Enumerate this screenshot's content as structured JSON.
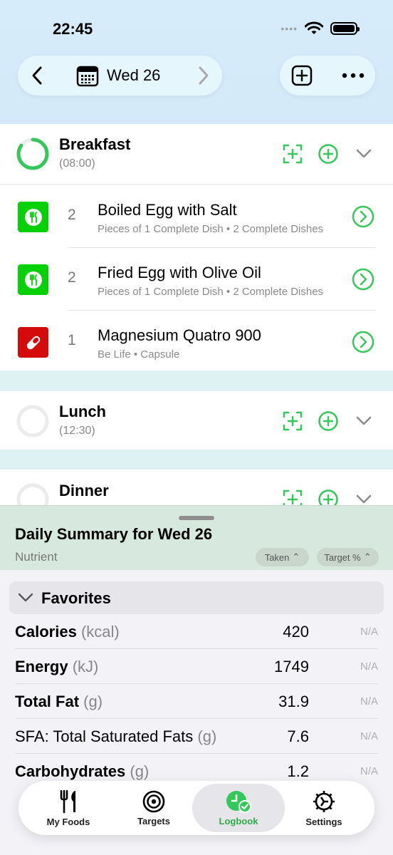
{
  "status_bar": {
    "time": "22:45"
  },
  "nav": {
    "date": "Wed 26",
    "icons": [
      "chevron-left-icon",
      "calendar-icon",
      "chevron-right-icon",
      "plus-square-icon",
      "more-icon"
    ]
  },
  "colors": {
    "accent_green": "#34c759",
    "food_green": "#06d006",
    "supplement_red": "#d50b0b"
  },
  "meals": [
    {
      "title": "Breakfast",
      "time": "(08:00)",
      "progress": 0.85,
      "items": [
        {
          "qty": "2",
          "name": "Boiled Egg with Salt",
          "sub": "Pieces of 1 Complete Dish • 2 Complete Dishes",
          "icon": "fork-knife-icon"
        },
        {
          "qty": "2",
          "name": "Fried Egg with Olive Oil",
          "sub": "Pieces of 1 Complete Dish • 2 Complete Dishes",
          "icon": "fork-knife-icon"
        },
        {
          "qty": "1",
          "name": "Magnesium Quatro 900",
          "sub": "Be Life • Capsule",
          "icon": "pill-icon"
        }
      ]
    },
    {
      "title": "Lunch",
      "time": "(12:30)",
      "progress": 0
    },
    {
      "title": "Dinner",
      "progress": 0
    }
  ],
  "summary": {
    "title": "Daily Summary for Wed 26",
    "column_label": "Nutrient",
    "sort_taken": "Taken",
    "sort_target": "Target %",
    "section": "Favorites",
    "rows": [
      {
        "name": "Calories",
        "unit": "(kcal)",
        "value": "420",
        "pct": "N/A",
        "bold": true
      },
      {
        "name": "Energy",
        "unit": "(kJ)",
        "value": "1749",
        "pct": "N/A",
        "bold": true
      },
      {
        "name": "Total Fat",
        "unit": "(g)",
        "value": "31.9",
        "pct": "N/A",
        "bold": true
      },
      {
        "name": "SFA: Total Saturated Fats",
        "unit": "(g)",
        "value": "7.6",
        "pct": "N/A",
        "bold": false
      },
      {
        "name": "Carbohydrates",
        "unit": "(g)",
        "value": "1.2",
        "pct": "N/A",
        "bold": true
      }
    ]
  },
  "tabbar": {
    "tabs": [
      {
        "label": "My Foods",
        "icon": "fork-knife-icon"
      },
      {
        "label": "Targets",
        "icon": "target-icon"
      },
      {
        "label": "Logbook",
        "icon": "logbook-icon",
        "active": true
      },
      {
        "label": "Settings",
        "icon": "gear-icon"
      }
    ]
  }
}
